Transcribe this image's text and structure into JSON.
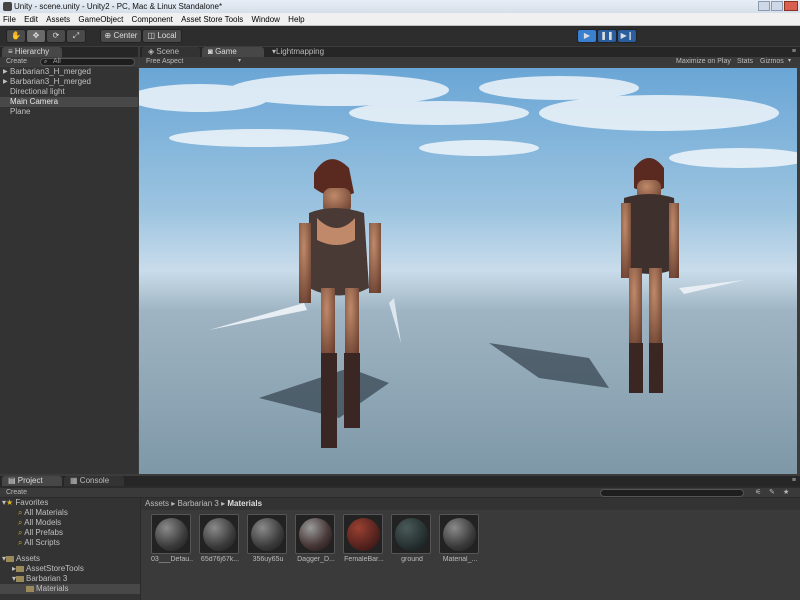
{
  "window": {
    "title": "Unity - scene.unity - Unity2 - PC, Mac & Linux Standalone*"
  },
  "menu": [
    "File",
    "Edit",
    "Assets",
    "GameObject",
    "Component",
    "Asset Store Tools",
    "Window",
    "Help"
  ],
  "toolbar": {
    "pivot_label": "Center",
    "space_label": "Local",
    "play_state": "playing"
  },
  "hierarchy": {
    "tab_label": "Hierarchy",
    "create_label": "Create",
    "search_placeholder": "All",
    "items": [
      "Barbarian3_H_merged",
      "Barbarian3_H_merged",
      "Directional light",
      "Main Camera",
      "Plane"
    ],
    "selected_index": 3
  },
  "view_tabs": {
    "scene": "Scene",
    "game": "Game",
    "lightmapping": "Lightmapping"
  },
  "game_bar": {
    "aspect": "Free Aspect",
    "maximize": "Maximize on Play",
    "stats": "Stats",
    "gizmos": "Gizmos"
  },
  "bottom_tabs": {
    "project": "Project",
    "console": "Console"
  },
  "project": {
    "create_label": "Create",
    "favorites_label": "Favorites",
    "favorites": [
      "All Materials",
      "All Models",
      "All Prefabs",
      "All Scripts"
    ],
    "assets_label": "Assets",
    "folders": [
      "AssetStoreTools",
      "Barbarian 3",
      "Materials"
    ],
    "breadcrumb": [
      "Assets",
      "Barbarian 3",
      "Materials"
    ]
  },
  "materials": [
    {
      "name": "03___Defau...",
      "style": "grey"
    },
    {
      "name": "65d76j67k...",
      "style": "grey"
    },
    {
      "name": "356uy65u",
      "style": "grey"
    },
    {
      "name": "Dagger_D...",
      "style": "dagger"
    },
    {
      "name": "FemaleBar...",
      "style": "female"
    },
    {
      "name": "ground",
      "style": "ground"
    },
    {
      "name": "Material_...",
      "style": "grey"
    }
  ],
  "colors": {
    "editor_bg": "#3c3c3c",
    "play_accent": "#3a7fd0",
    "sky_top": "#6aa6d6",
    "ground": "#8fa6b4"
  }
}
